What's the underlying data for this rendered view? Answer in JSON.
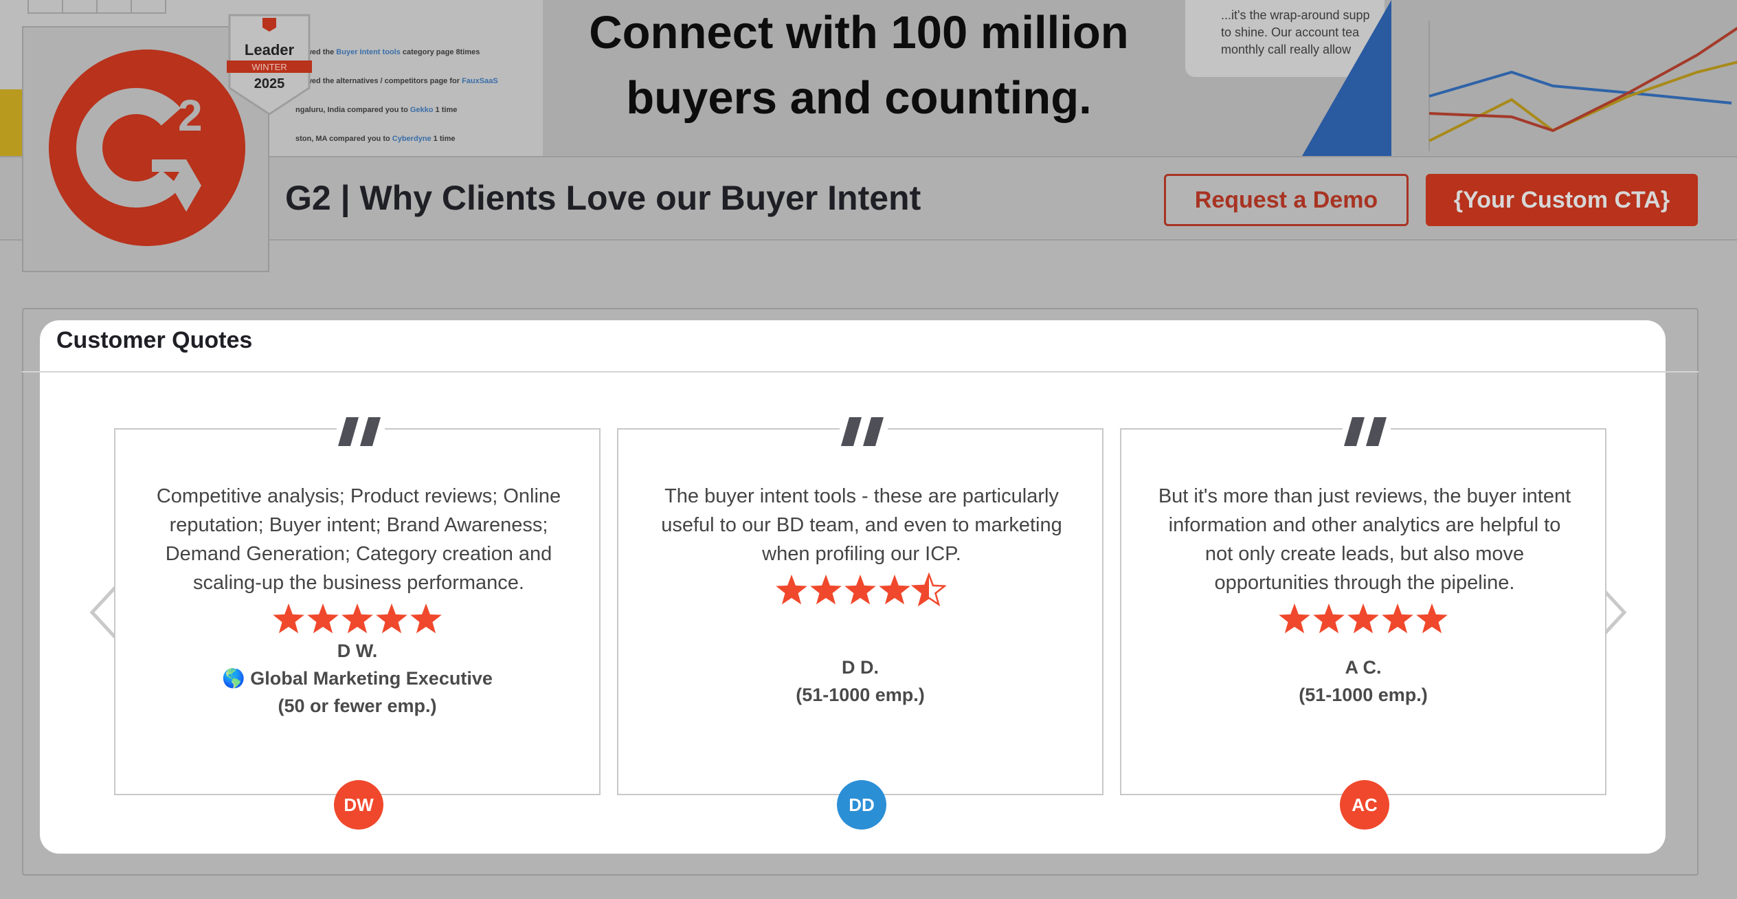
{
  "banner": {
    "headline_line1": "Connect with 100 million",
    "headline_line2": "buyers and counting.",
    "activity": [
      {
        "pre": "viewed the ",
        "hl": "Buyer Intent tools",
        "post": " category page 8times"
      },
      {
        "pre": "viewed the alternatives / competitors page for ",
        "hl": "FauxSaaS",
        "post": ""
      },
      {
        "pre": "ngaluru, India compared you to ",
        "hl": "Gekko",
        "post": " 1 time"
      },
      {
        "pre": "ston, MA compared you to ",
        "hl": "Cyberdyne",
        "post": " 1 time"
      }
    ],
    "testimonial_line1": "...it's the wrap-around supp",
    "testimonial_line2": "to shine. Our account tea",
    "testimonial_line3": "monthly call really allow"
  },
  "badge": {
    "title": "Leader",
    "season": "WINTER",
    "year": "2025"
  },
  "header": {
    "title": "G2 | Why Clients Love our Buyer Intent",
    "demo_button": "Request a Demo",
    "cta_button": "{Your Custom CTA}"
  },
  "quotes": {
    "section_title": "Customer Quotes",
    "items": [
      {
        "text": "Competitive analysis; Product reviews; Online reputation; Buyer intent; Brand Awareness; Demand Generation; Category creation and scaling-up the business performance.",
        "rating": 5,
        "name": "D W.",
        "role": "🌎 Global Marketing Executive",
        "company_size": "(50 or fewer emp.)",
        "initials": "DW",
        "avatar_color": "#f0482c"
      },
      {
        "text": "The buyer intent tools - these are particularly useful to our BD team, and even to marketing when profiling our ICP.",
        "rating": 4.5,
        "name": "D D.",
        "company_size": "(51-1000 emp.)",
        "initials": "DD",
        "avatar_color": "#2b8fd6"
      },
      {
        "text": "But it's more than just reviews, the buyer intent information and other analytics are helpful to not only create leads, but also move opportunities through the pipeline.",
        "rating": 5,
        "name": "A C.",
        "company_size": "(51-1000 emp.)",
        "initials": "AC",
        "avatar_color": "#f0482c"
      }
    ]
  },
  "colors": {
    "accent": "#f0482c",
    "brand_dark": "#b8321c",
    "panel_bg": "#ffffff",
    "overlay": "#b3b3b3"
  }
}
